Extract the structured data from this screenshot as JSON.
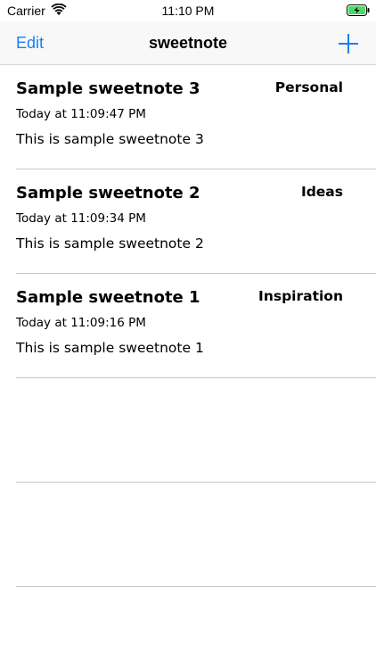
{
  "status_bar": {
    "carrier": "Carrier",
    "time": "11:10 PM",
    "wifi_icon": "wifi-icon",
    "battery_icon": "battery-charging-icon",
    "battery_color": "#4cd964"
  },
  "nav": {
    "edit_label": "Edit",
    "title": "sweetnote",
    "add_icon": "plus-icon",
    "accent_color": "#1a7ff0"
  },
  "notes": [
    {
      "title": "Sample sweetnote 3",
      "category": "Personal",
      "date": "Today at 11:09:47 PM",
      "body": "This is sample sweetnote 3"
    },
    {
      "title": "Sample sweetnote 2",
      "category": "Ideas",
      "date": "Today at 11:09:34 PM",
      "body": "This is sample sweetnote 2"
    },
    {
      "title": "Sample sweetnote 1",
      "category": "Inspiration",
      "date": "Today at 11:09:16 PM",
      "body": "This is sample sweetnote 1"
    }
  ]
}
